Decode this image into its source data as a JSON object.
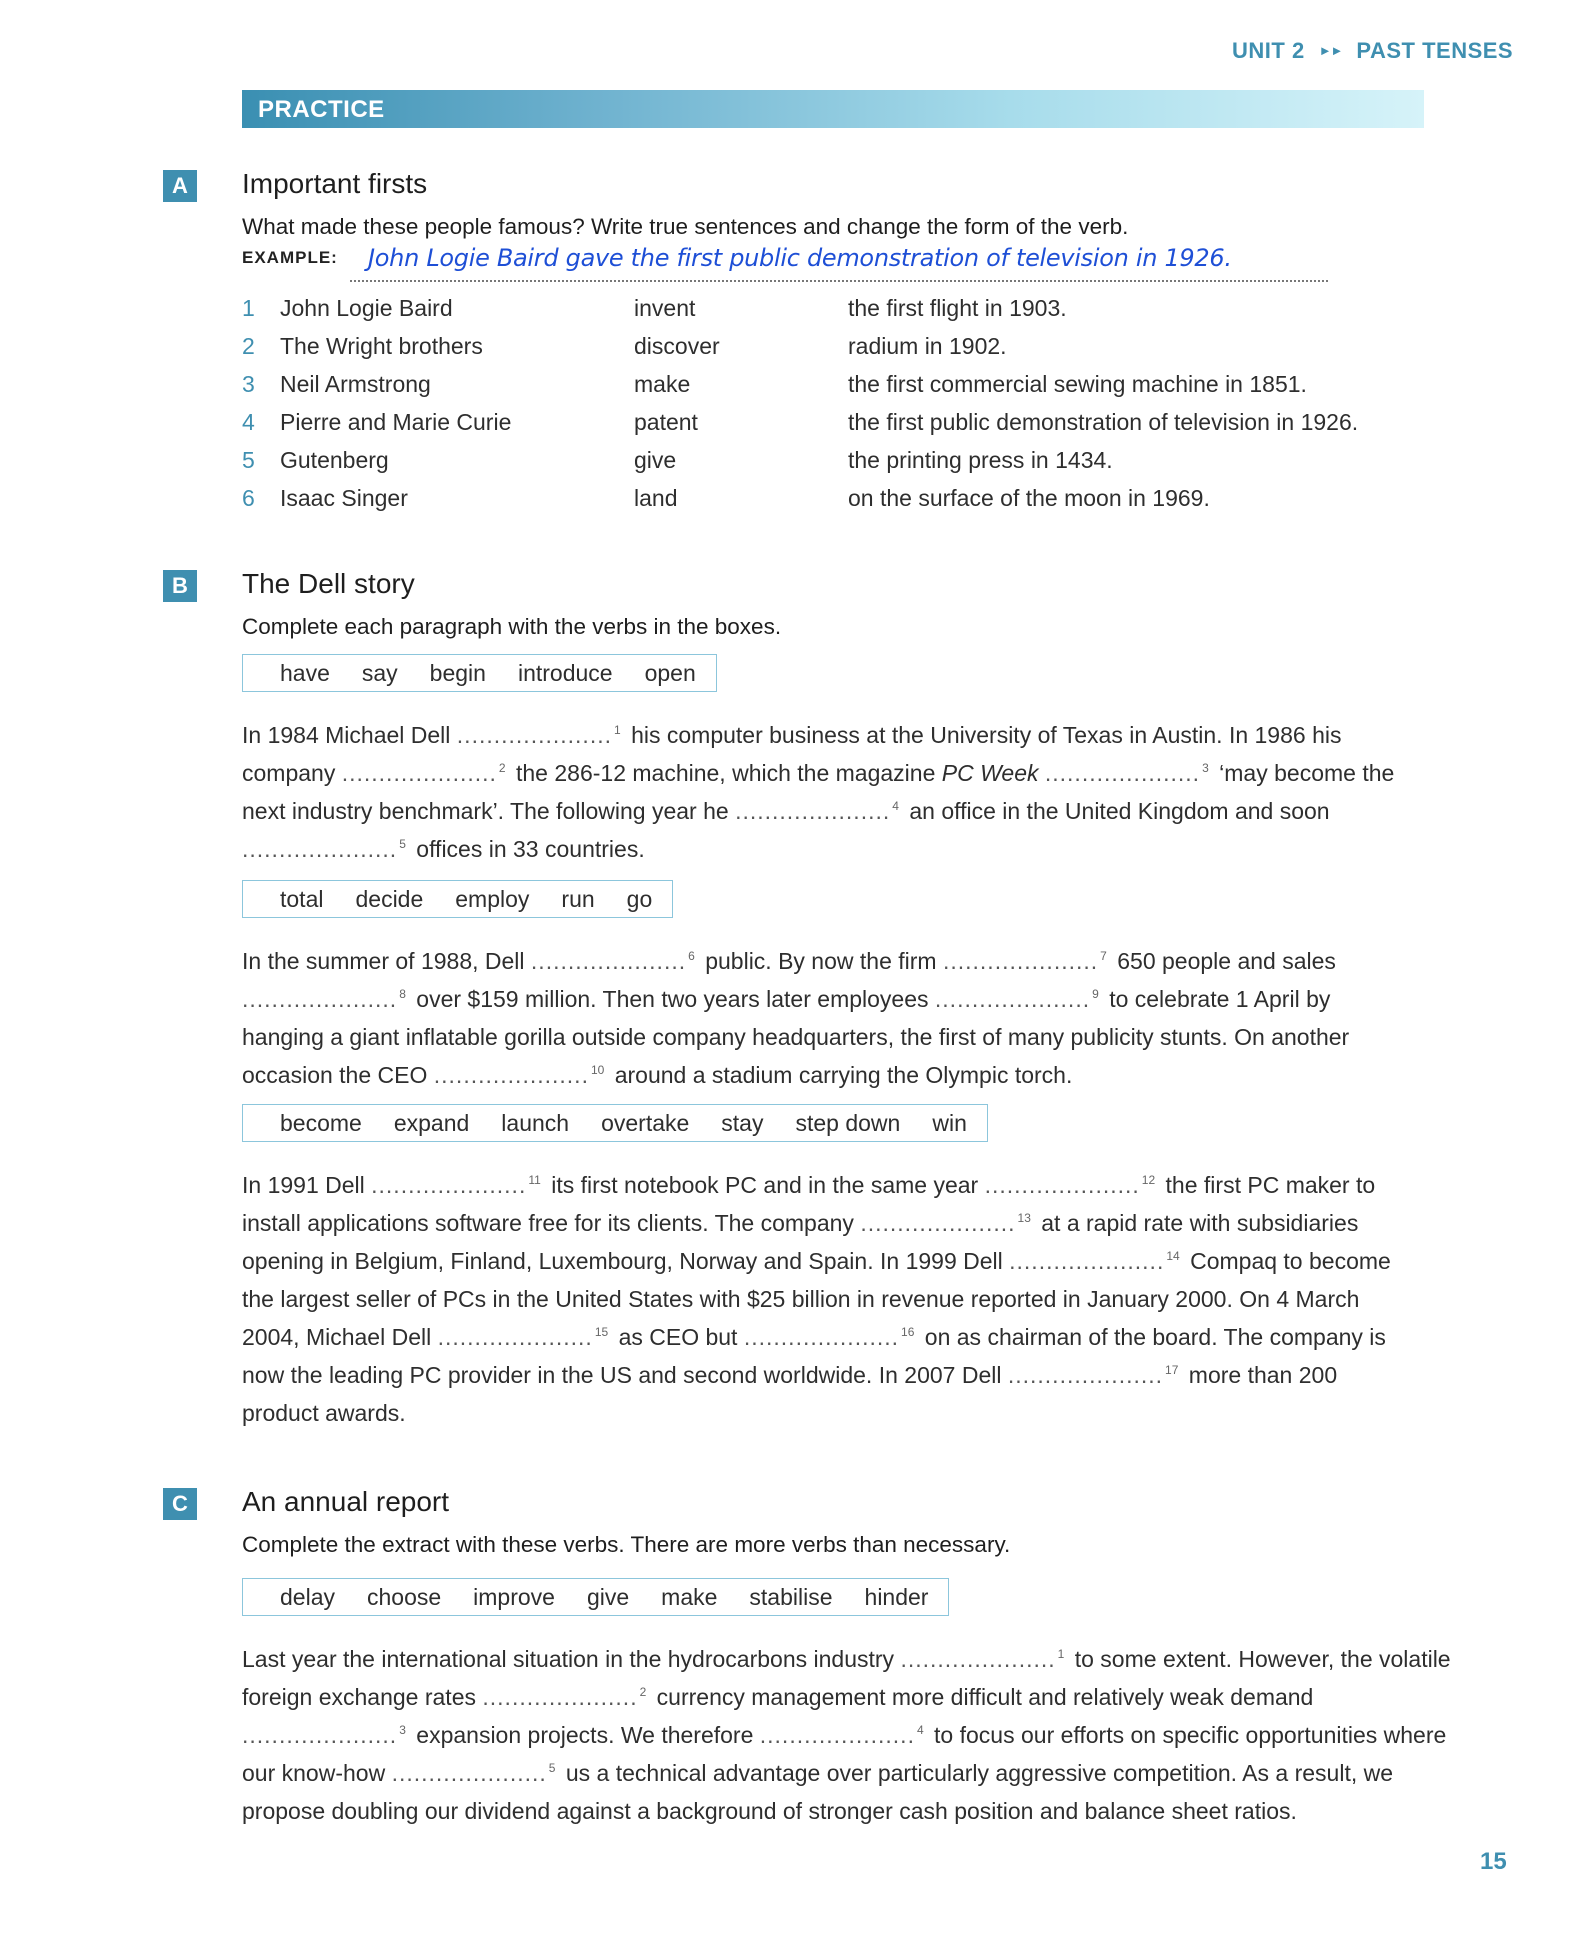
{
  "running_head": {
    "unit": "UNIT 2",
    "arrows": "►►",
    "topic": "PAST TENSES"
  },
  "banner": {
    "label": "PRACTICE"
  },
  "sections": {
    "a": {
      "badge": "A",
      "title": "Important firsts",
      "instruction": "What made these people famous? Write true sentences and change the form of the verb.",
      "example_label": "EXAMPLE:",
      "example_answer": "John Logie Baird gave the first public demonstration of television in 1926.",
      "rows": [
        {
          "num": "1",
          "who": "John Logie Baird",
          "verb": "invent",
          "what": "the first flight in 1903."
        },
        {
          "num": "2",
          "who": "The Wright brothers",
          "verb": "discover",
          "what": "radium in 1902."
        },
        {
          "num": "3",
          "who": "Neil Armstrong",
          "verb": "make",
          "what": "the first commercial sewing machine in 1851."
        },
        {
          "num": "4",
          "who": "Pierre and Marie Curie",
          "verb": "patent",
          "what": "the first public demonstration of television in 1926."
        },
        {
          "num": "5",
          "who": "Gutenberg",
          "verb": "give",
          "what": "the printing press in 1434."
        },
        {
          "num": "6",
          "who": "Isaac Singer",
          "verb": "land",
          "what": "on the surface of the moon in 1969."
        }
      ]
    },
    "b": {
      "badge": "B",
      "title": "The Dell story",
      "instruction": "Complete each paragraph with the verbs in the boxes.",
      "box1": [
        "have",
        "say",
        "begin",
        "introduce",
        "open"
      ],
      "box2": [
        "total",
        "decide",
        "employ",
        "run",
        "go"
      ],
      "box3": [
        "become",
        "expand",
        "launch",
        "overtake",
        "stay",
        "step down",
        "win"
      ],
      "gap": ".....................",
      "p1": {
        "t1": "In 1984 Michael Dell",
        "n1": "1",
        "t2": "his computer business at the University of Texas in Austin. In 1986 his company",
        "n2": "2",
        "t3": "the 286-12 machine, which the magazine",
        "italic": "PC Week",
        "n3": "3",
        "t4": "‘may become the next industry benchmark’. The following year he",
        "n4": "4",
        "t5": "an office in the United Kingdom and soon",
        "n5": "5",
        "t6": "offices in 33 countries."
      },
      "p2": {
        "t1": "In the summer of 1988, Dell",
        "n6": "6",
        "t2": "public. By now the firm",
        "n7": "7",
        "t3": "650 people and sales",
        "n8": "8",
        "t4": "over $159 million. Then two years later employees",
        "n9": "9",
        "t5": "to celebrate 1 April by hanging a giant inflatable gorilla outside company headquarters, the first of many publicity stunts. On another occasion the CEO",
        "n10": "10",
        "t6": "around a stadium carrying the Olympic torch."
      },
      "p3": {
        "t1": "In 1991 Dell",
        "n11": "11",
        "t2": "its first notebook PC and in the same year",
        "n12": "12",
        "t3": "the first PC maker to install applications software free for its clients. The company",
        "n13": "13",
        "t4": "at a rapid rate with subsidiaries opening in Belgium, Finland, Luxembourg, Norway and Spain. In 1999 Dell",
        "n14": "14",
        "t5": "Compaq to become the largest seller of PCs in the United States with $25 billion in revenue reported in January 2000. On 4 March 2004, Michael Dell",
        "n15": "15",
        "t6": "as CEO but",
        "n16": "16",
        "t7": "on as chairman of the board. The company is now the leading PC provider in the US and second worldwide. In 2007 Dell",
        "n17": "17",
        "t8": "more than 200 product awards."
      }
    },
    "c": {
      "badge": "C",
      "title": "An annual report",
      "instruction": "Complete the extract with these verbs. There are more verbs than necessary.",
      "box": [
        "delay",
        "choose",
        "improve",
        "give",
        "make",
        "stabilise",
        "hinder"
      ],
      "p": {
        "t1": "Last year the international situation in the hydrocarbons industry",
        "n1": "1",
        "t2": "to some extent. However, the volatile foreign exchange rates",
        "n2": "2",
        "t3": "currency management more difficult and relatively weak demand",
        "n3": "3",
        "t4": "expansion projects. We therefore",
        "n4": "4",
        "t5": "to focus our efforts on specific opportunities where our know-how",
        "n5": "5",
        "t6": "us a technical advantage over particularly aggressive competition. As a result, we propose doubling our dividend against a background of stronger cash position and balance sheet ratios."
      }
    }
  },
  "page_number": "15",
  "colors": {
    "accent": "#3f8fb0",
    "handwriting": "#1e4fd6",
    "box_border": "#8cc6dc"
  }
}
